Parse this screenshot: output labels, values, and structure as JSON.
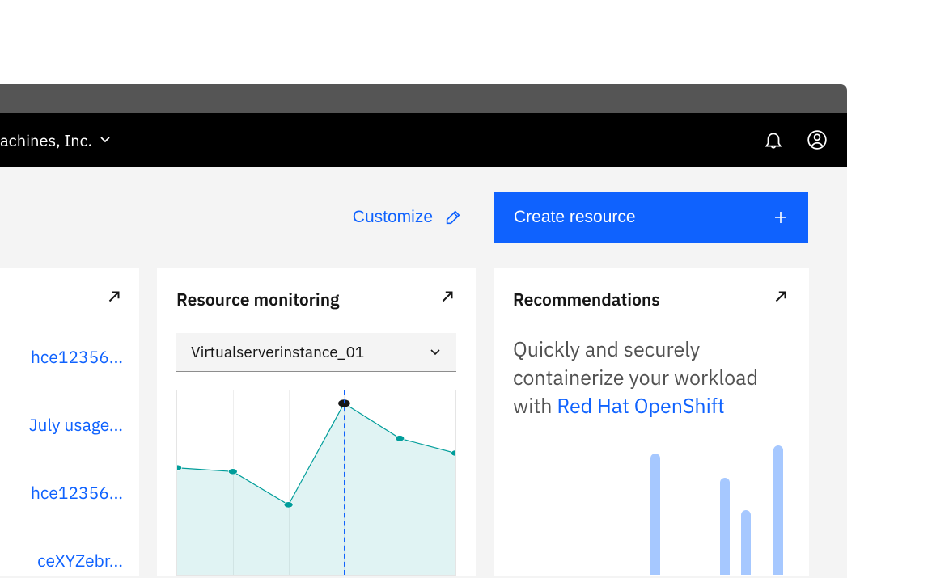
{
  "header": {
    "account_label": "achines, Inc."
  },
  "actions": {
    "customize_label": "Customize",
    "create_resource_label": "Create resource"
  },
  "partial_card": {
    "links": [
      "hce12356...",
      "July usage...",
      "hce12356...",
      "ceXYZebr..."
    ]
  },
  "resource_monitoring": {
    "title": "Resource monitoring",
    "dropdown_value": "Virtualserverinstance_01"
  },
  "recommendations": {
    "title": "Recommendations",
    "text_prefix": "Quickly and securely containerize your workload with ",
    "link_text": "Red Hat OpenShift"
  },
  "chart_data": {
    "type": "line",
    "x": [
      0,
      1,
      2,
      3,
      4,
      5
    ],
    "values": [
      58,
      56,
      38,
      93,
      74,
      66
    ],
    "ylim": [
      0,
      100
    ],
    "marker_x": 3
  }
}
